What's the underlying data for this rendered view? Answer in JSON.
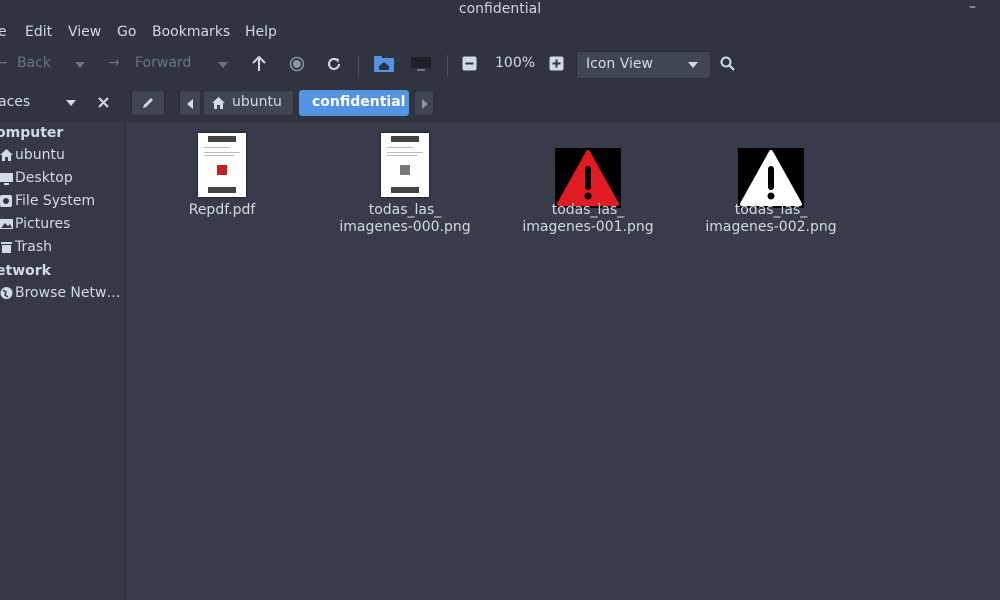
{
  "window": {
    "title": "confidential"
  },
  "menu": [
    "e",
    "Edit",
    "View",
    "Go",
    "Bookmarks",
    "Help"
  ],
  "toolbar": {
    "back": "Back",
    "forward": "Forward",
    "zoom": "100%",
    "view_mode": "Icon View"
  },
  "pathbar": {
    "places_label": "aces",
    "crumbs": [
      "ubuntu",
      "confidential"
    ]
  },
  "sidebar": {
    "computer_heading": "omputer",
    "computer_items": [
      "ubuntu",
      "Desktop",
      "File System",
      "Pictures",
      "Trash"
    ],
    "network_heading": "etwork",
    "network_items": [
      "Browse Netw…"
    ]
  },
  "files": [
    {
      "line1": "Repdf.pdf",
      "line2": ""
    },
    {
      "line1": "todas_las_",
      "line2": "imagenes-000.png"
    },
    {
      "line1": "todas_las_",
      "line2": "imagenes-001.png"
    },
    {
      "line1": "todas_las_",
      "line2": "imagenes-002.png"
    }
  ],
  "colors": {
    "accent": "#5294e2",
    "warning_red": "#e01b24"
  }
}
